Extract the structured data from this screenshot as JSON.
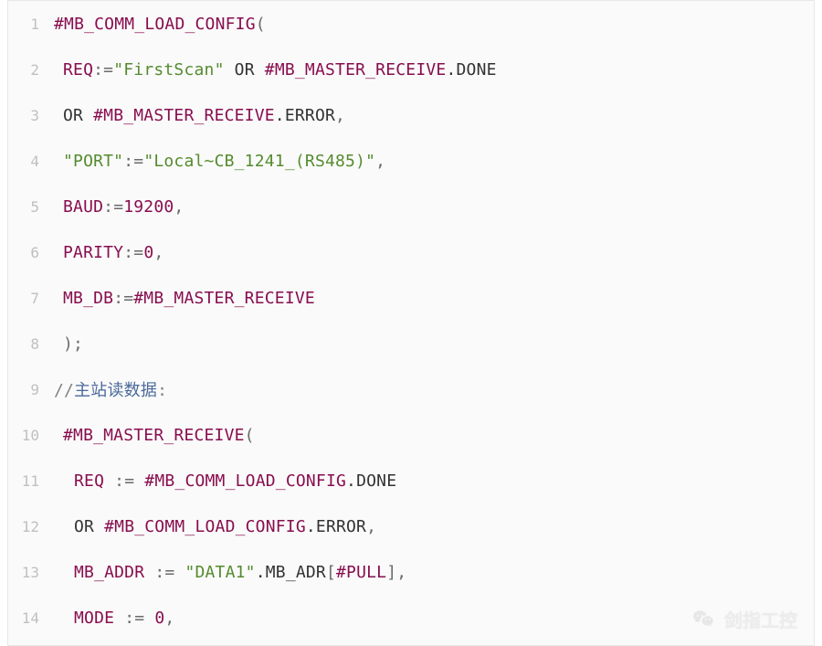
{
  "watermark": "剑指工控",
  "code": {
    "lines": [
      {
        "n": 1,
        "indent": 0,
        "tokens": [
          {
            "cls": "t-macro",
            "text": "#MB_COMM_LOAD_CONFIG"
          },
          {
            "cls": "t-paren",
            "text": "("
          }
        ]
      },
      {
        "n": 2,
        "indent": 1,
        "tokens": [
          {
            "cls": "t-key",
            "text": "REQ"
          },
          {
            "cls": "t-op",
            "text": ":="
          },
          {
            "cls": "t-string",
            "text": "\"FirstScan\""
          },
          {
            "cls": "",
            "text": " "
          },
          {
            "cls": "t-kw",
            "text": "OR"
          },
          {
            "cls": "",
            "text": " "
          },
          {
            "cls": "t-macro",
            "text": "#MB_MASTER_RECEIVE"
          },
          {
            "cls": "t-member",
            "text": ".DONE"
          }
        ]
      },
      {
        "n": 3,
        "indent": 1,
        "tokens": [
          {
            "cls": "t-kw",
            "text": "OR"
          },
          {
            "cls": "",
            "text": " "
          },
          {
            "cls": "t-macro",
            "text": "#MB_MASTER_RECEIVE"
          },
          {
            "cls": "t-member",
            "text": ".ERROR"
          },
          {
            "cls": "t-punct",
            "text": ","
          }
        ]
      },
      {
        "n": 4,
        "indent": 1,
        "tokens": [
          {
            "cls": "t-string",
            "text": "\"PORT\""
          },
          {
            "cls": "t-op",
            "text": ":="
          },
          {
            "cls": "t-string",
            "text": "\"Local~CB_1241_(RS485)\""
          },
          {
            "cls": "t-punct",
            "text": ","
          }
        ]
      },
      {
        "n": 5,
        "indent": 1,
        "tokens": [
          {
            "cls": "t-key",
            "text": "BAUD"
          },
          {
            "cls": "t-op",
            "text": ":="
          },
          {
            "cls": "t-num",
            "text": "19200"
          },
          {
            "cls": "t-punct",
            "text": ","
          }
        ]
      },
      {
        "n": 6,
        "indent": 1,
        "tokens": [
          {
            "cls": "t-key",
            "text": "PARITY"
          },
          {
            "cls": "t-op",
            "text": ":="
          },
          {
            "cls": "t-num",
            "text": "0"
          },
          {
            "cls": "t-punct",
            "text": ","
          }
        ]
      },
      {
        "n": 7,
        "indent": 1,
        "tokens": [
          {
            "cls": "t-key",
            "text": "MB_DB"
          },
          {
            "cls": "t-op",
            "text": ":="
          },
          {
            "cls": "t-macro",
            "text": "#MB_MASTER_RECEIVE"
          }
        ]
      },
      {
        "n": 8,
        "indent": 1,
        "tokens": [
          {
            "cls": "t-paren",
            "text": ")"
          },
          {
            "cls": "t-punct",
            "text": ";"
          }
        ]
      },
      {
        "n": 9,
        "indent": 0,
        "tokens": [
          {
            "cls": "t-comment",
            "text": "//"
          },
          {
            "cls": "t-comment-zh",
            "text": "主站读数据"
          },
          {
            "cls": "t-comment",
            "text": ":"
          }
        ]
      },
      {
        "n": 10,
        "indent": 1,
        "tokens": [
          {
            "cls": "t-macro",
            "text": "#MB_MASTER_RECEIVE"
          },
          {
            "cls": "t-paren",
            "text": "("
          }
        ]
      },
      {
        "n": 11,
        "indent": 2,
        "tokens": [
          {
            "cls": "t-key",
            "text": "REQ"
          },
          {
            "cls": "",
            "text": " "
          },
          {
            "cls": "t-op",
            "text": ":="
          },
          {
            "cls": "",
            "text": " "
          },
          {
            "cls": "t-macro",
            "text": "#MB_COMM_LOAD_CONFIG"
          },
          {
            "cls": "t-member",
            "text": ".DONE"
          }
        ]
      },
      {
        "n": 12,
        "indent": 2,
        "tokens": [
          {
            "cls": "t-kw",
            "text": "OR"
          },
          {
            "cls": "",
            "text": " "
          },
          {
            "cls": "t-macro",
            "text": "#MB_COMM_LOAD_CONFIG"
          },
          {
            "cls": "t-member",
            "text": ".ERROR"
          },
          {
            "cls": "t-punct",
            "text": ","
          }
        ]
      },
      {
        "n": 13,
        "indent": 2,
        "tokens": [
          {
            "cls": "t-key",
            "text": "MB_ADDR"
          },
          {
            "cls": "",
            "text": " "
          },
          {
            "cls": "t-op",
            "text": ":="
          },
          {
            "cls": "",
            "text": " "
          },
          {
            "cls": "t-string",
            "text": "\"DATA1\""
          },
          {
            "cls": "t-member",
            "text": ".MB_ADR"
          },
          {
            "cls": "t-punct",
            "text": "["
          },
          {
            "cls": "t-macro",
            "text": "#PULL"
          },
          {
            "cls": "t-punct",
            "text": "]"
          },
          {
            "cls": "t-punct",
            "text": ","
          }
        ]
      },
      {
        "n": 14,
        "indent": 2,
        "tokens": [
          {
            "cls": "t-key",
            "text": "MODE"
          },
          {
            "cls": "",
            "text": " "
          },
          {
            "cls": "t-op",
            "text": ":="
          },
          {
            "cls": "",
            "text": " "
          },
          {
            "cls": "t-num",
            "text": "0"
          },
          {
            "cls": "t-punct",
            "text": ","
          }
        ]
      }
    ]
  }
}
